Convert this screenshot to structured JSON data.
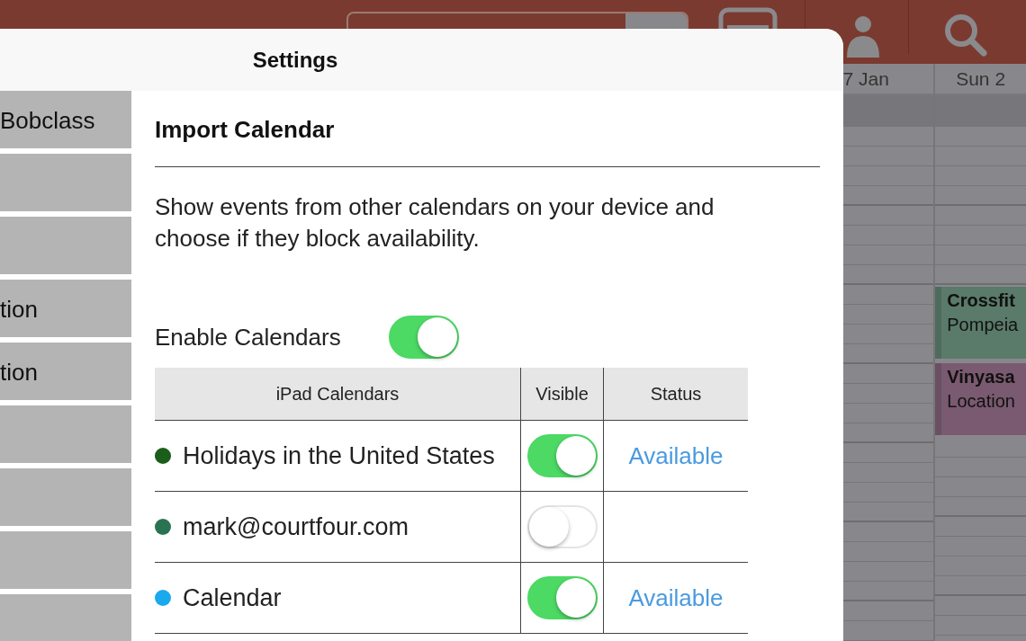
{
  "calendar_background": {
    "day_headers": [
      "7 Jan",
      "Sun 2"
    ],
    "events": [
      {
        "title": "Crossfit",
        "location": "Pompeia",
        "color": "#5a7a6a"
      },
      {
        "title": "Vinyasa",
        "location": "Location",
        "color": "#7a5a70"
      }
    ]
  },
  "window": {
    "title": "Settings"
  },
  "sidebar": {
    "items": [
      {
        "kind": "text",
        "label": "Bobclass"
      },
      {
        "kind": "blank"
      },
      {
        "kind": "blank"
      },
      {
        "kind": "text",
        "label": "tion"
      },
      {
        "kind": "text",
        "label": "tion"
      },
      {
        "kind": "blank"
      },
      {
        "kind": "blank"
      },
      {
        "kind": "blank"
      },
      {
        "kind": "blank"
      }
    ]
  },
  "section": {
    "title": "Import Calendar",
    "description": "Show events from other calendars on your device and choose if they block availability.",
    "enable": {
      "label": "Enable Calendars",
      "on": true
    }
  },
  "table": {
    "columns": [
      "iPad Calendars",
      "Visible",
      "Status"
    ],
    "rows": [
      {
        "name": "Holidays in the United States",
        "color": "#1b5e1b",
        "visible": true,
        "status": "Available"
      },
      {
        "name": "mark@courtfour.com",
        "color": "#2a7352",
        "visible": false
      },
      {
        "name": "Calendar",
        "color": "#1aa9ec",
        "visible": true,
        "status": "Available"
      }
    ]
  }
}
